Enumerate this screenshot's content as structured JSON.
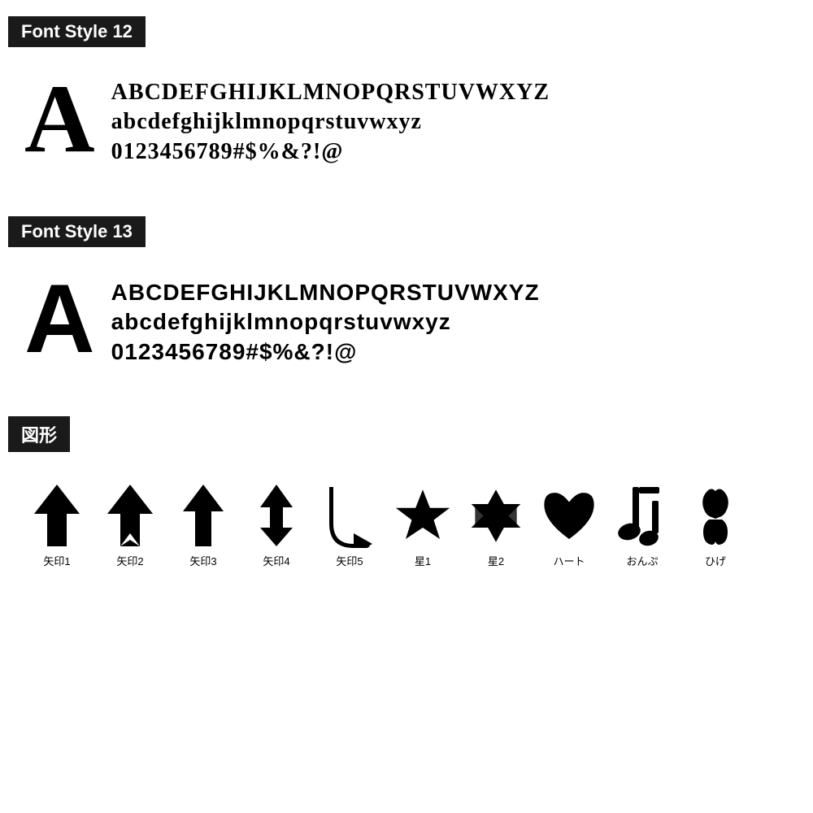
{
  "sections": [
    {
      "id": "font-style-12",
      "label": "Font Style 12",
      "big_letter": "A",
      "style": "serif",
      "rows": [
        "ABCDEFGHIJKLMNOPQRSTUVWXYZ",
        "abcdefghijklmnopqrstuvwxyz",
        "0123456789#$%&?!@"
      ]
    },
    {
      "id": "font-style-13",
      "label": "Font Style 13",
      "big_letter": "A",
      "style": "sans-serif",
      "rows": [
        "ABCDEFGHIJKLMNOPQRSTUVWXYZ",
        "abcdefghijklmnopqrstuvwxyz",
        "0123456789#$%&?!@"
      ]
    }
  ],
  "shapes_section": {
    "label": "図形",
    "items": [
      {
        "name": "矢印1",
        "type": "arrow1"
      },
      {
        "name": "矢印2",
        "type": "arrow2"
      },
      {
        "name": "矢印3",
        "type": "arrow3"
      },
      {
        "name": "矢印4",
        "type": "arrow4"
      },
      {
        "name": "矢印5",
        "type": "arrow5"
      },
      {
        "name": "星1",
        "type": "star1"
      },
      {
        "name": "星2",
        "type": "star2"
      },
      {
        "name": "ハート",
        "type": "heart"
      },
      {
        "name": "おんぷ",
        "type": "music"
      },
      {
        "name": "ひげ",
        "type": "mustache"
      }
    ]
  }
}
